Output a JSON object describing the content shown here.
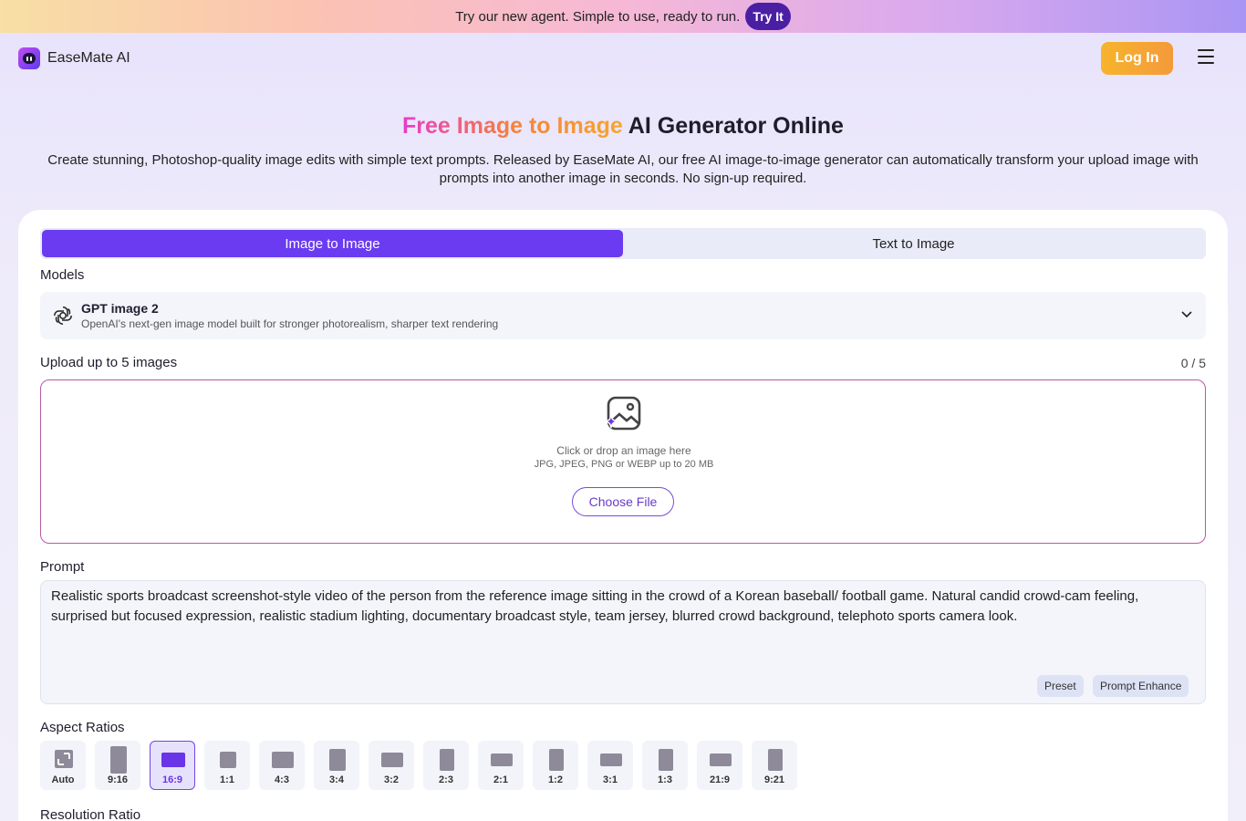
{
  "banner": {
    "text": "Try our new agent. Simple to use, ready to run.",
    "cta": "Try It"
  },
  "header": {
    "brand": "EaseMate AI",
    "login": "Log In"
  },
  "hero": {
    "title_highlight": "Free Image to Image",
    "title_rest": " AI Generator Online",
    "description": "Create stunning, Photoshop-quality image edits with simple text prompts. Released by EaseMate AI, our free AI image-to-image generator can automatically transform your upload image with prompts into another image in seconds. No sign-up required."
  },
  "tabs": [
    {
      "label": "Image to Image",
      "active": true
    },
    {
      "label": "Text to Image",
      "active": false
    }
  ],
  "models": {
    "label": "Models",
    "selected_name": "GPT image 2",
    "selected_desc": "OpenAI's next-gen image model built for stronger photorealism, sharper text rendering"
  },
  "upload": {
    "label": "Upload up to 5 images",
    "count": "0 / 5",
    "hint": "Click or drop an image here",
    "formats": "JPG, JPEG, PNG or WEBP up to 20 MB",
    "button": "Choose File"
  },
  "prompt": {
    "label": "Prompt",
    "value": "Realistic sports broadcast screenshot-style video of the person from the reference image sitting in the crowd of a Korean baseball/ football game. Natural candid crowd-cam feeling, surprised but focused expression, realistic stadium lighting, documentary broadcast style, team jersey, blurred crowd background, telephoto sports camera look.",
    "preset": "Preset",
    "enhance": "Prompt Enhance"
  },
  "aspect": {
    "label": "Aspect Ratios",
    "selected": "16:9",
    "options": [
      "Auto",
      "9:16",
      "16:9",
      "1:1",
      "4:3",
      "3:4",
      "3:2",
      "2:3",
      "2:1",
      "1:2",
      "3:1",
      "1:3",
      "21:9",
      "9:21"
    ]
  },
  "resolution": {
    "label": "Resolution Ratio"
  },
  "colors": {
    "accent": "#6a3bf0",
    "login": "#f7b42c",
    "banner_cta": "#4b1fa3"
  }
}
